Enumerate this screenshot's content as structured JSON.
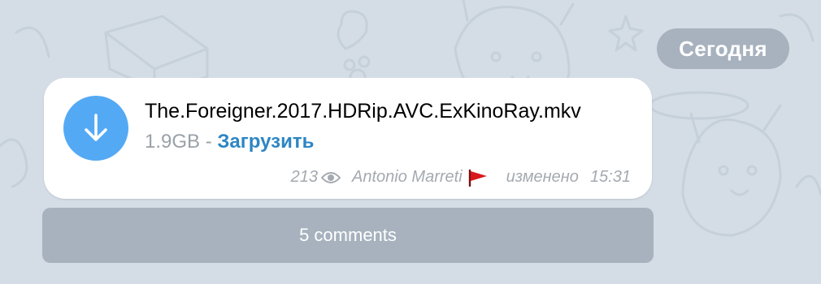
{
  "date_separator": "Сегодня",
  "message": {
    "file_name": "The.Foreigner.2017.HDRip.AVC.ExKinoRay.mkv",
    "file_size": "1.9GB",
    "separator": "-",
    "download_label": "Загрузить",
    "views": "213",
    "author": "Antonio Marreti",
    "edited_label": "изменено",
    "time": "15:31"
  },
  "comments": {
    "label": "5 comments"
  },
  "colors": {
    "accent": "#54a9f4",
    "link": "#2d86c4",
    "flag": "#d9191d"
  },
  "icons": {
    "download": "download-arrow-icon",
    "views": "eye-icon",
    "flag": "red-flag-icon"
  }
}
